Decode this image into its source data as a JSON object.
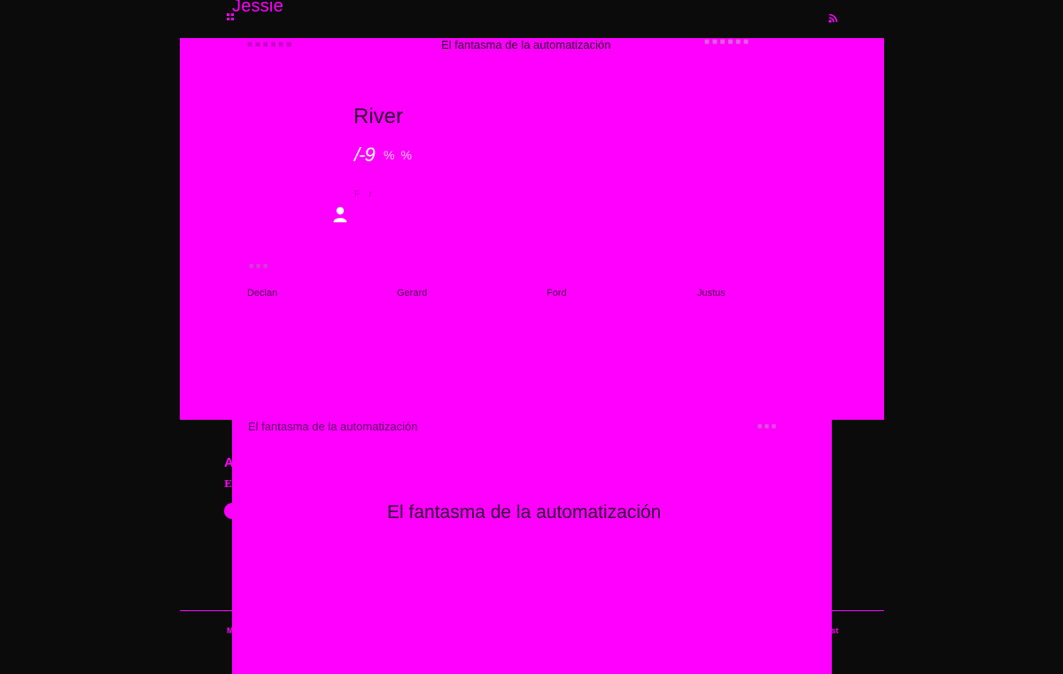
{
  "site": {
    "title": "Jessie",
    "rss_icon": "rss-icon",
    "grid_icon": "grid-icon"
  },
  "background": {
    "article_title": "A",
    "article_sub": "El",
    "footer_left": "M",
    "footer_right": "ost"
  },
  "overlay_top": {
    "nav_left": "■ ■ ■ ■ ■ ■",
    "nav_center": "El fantasma de la automatización",
    "nav_right": "■ ■ ■ ■ ■ ■",
    "title": "River",
    "subtitle": "/-9",
    "subtitle_faint": "% %",
    "label": "F   r",
    "user_icon": "user-icon",
    "section_label": "■ ■ ■",
    "names": [
      "Declan",
      "Gerard",
      "Ford",
      "Justus"
    ]
  },
  "overlay_bottom": {
    "left_text": "El fantasma de la automatización",
    "right_text": "■ ■ ■",
    "heading": "El fantasma de la automatización"
  },
  "colors": {
    "background": "#0b0b0c",
    "overlay": "#ff00ff"
  }
}
